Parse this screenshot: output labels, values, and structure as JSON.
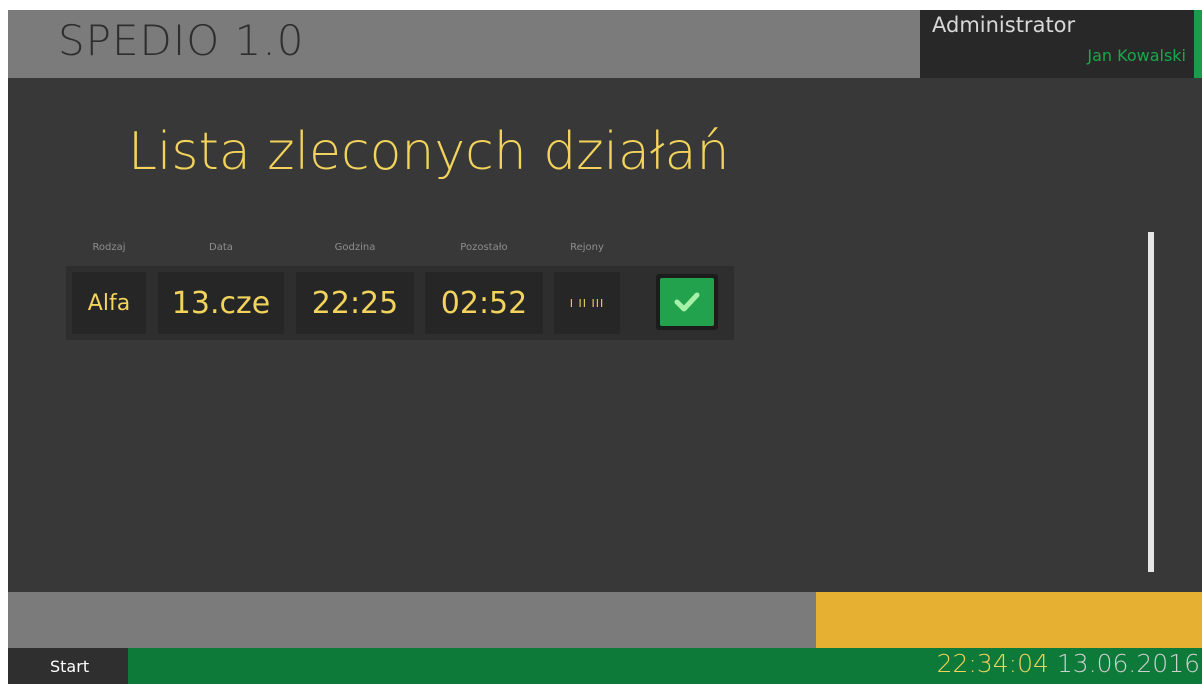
{
  "header": {
    "app_title": "SPEDIO 1.0",
    "user_role": "Administrator",
    "user_name": "Jan Kowalski"
  },
  "page": {
    "title": "Lista zleconych działań"
  },
  "table": {
    "columns": [
      "Rodzaj",
      "Data",
      "Godzina",
      "Pozostało",
      "Rejony"
    ],
    "rows": [
      {
        "rodzaj": "Alfa",
        "data": "13.cze",
        "godzina": "22:25",
        "pozostalo": "02:52",
        "rejony": "I II III",
        "action_icon": "checkmark-icon"
      }
    ]
  },
  "taskbar": {
    "start_label": "Start",
    "time": "22:34:04",
    "date": "13.06.2016"
  },
  "colors": {
    "accent_yellow": "#f2d35b",
    "accent_green": "#1aa84c",
    "taskbar_green": "#0e7a3a",
    "warning_yellow": "#e6b032",
    "background": "#383838"
  }
}
